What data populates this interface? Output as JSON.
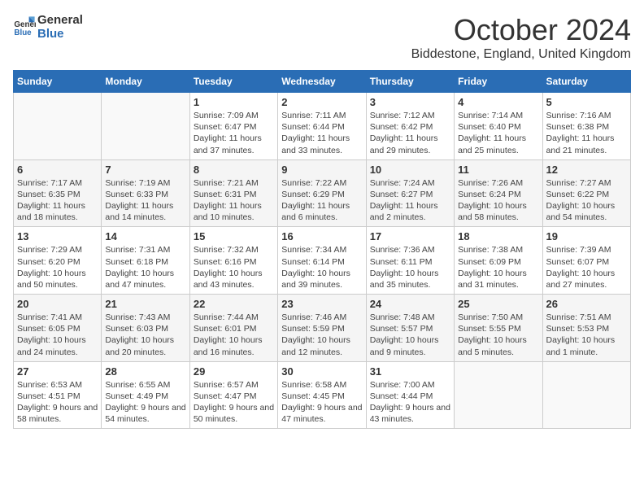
{
  "logo": {
    "text_general": "General",
    "text_blue": "Blue"
  },
  "header": {
    "month": "October 2024",
    "location": "Biddestone, England, United Kingdom"
  },
  "days_of_week": [
    "Sunday",
    "Monday",
    "Tuesday",
    "Wednesday",
    "Thursday",
    "Friday",
    "Saturday"
  ],
  "weeks": [
    [
      {
        "day": "",
        "sunrise": "",
        "sunset": "",
        "daylight": ""
      },
      {
        "day": "",
        "sunrise": "",
        "sunset": "",
        "daylight": ""
      },
      {
        "day": "1",
        "sunrise": "Sunrise: 7:09 AM",
        "sunset": "Sunset: 6:47 PM",
        "daylight": "Daylight: 11 hours and 37 minutes."
      },
      {
        "day": "2",
        "sunrise": "Sunrise: 7:11 AM",
        "sunset": "Sunset: 6:44 PM",
        "daylight": "Daylight: 11 hours and 33 minutes."
      },
      {
        "day": "3",
        "sunrise": "Sunrise: 7:12 AM",
        "sunset": "Sunset: 6:42 PM",
        "daylight": "Daylight: 11 hours and 29 minutes."
      },
      {
        "day": "4",
        "sunrise": "Sunrise: 7:14 AM",
        "sunset": "Sunset: 6:40 PM",
        "daylight": "Daylight: 11 hours and 25 minutes."
      },
      {
        "day": "5",
        "sunrise": "Sunrise: 7:16 AM",
        "sunset": "Sunset: 6:38 PM",
        "daylight": "Daylight: 11 hours and 21 minutes."
      }
    ],
    [
      {
        "day": "6",
        "sunrise": "Sunrise: 7:17 AM",
        "sunset": "Sunset: 6:35 PM",
        "daylight": "Daylight: 11 hours and 18 minutes."
      },
      {
        "day": "7",
        "sunrise": "Sunrise: 7:19 AM",
        "sunset": "Sunset: 6:33 PM",
        "daylight": "Daylight: 11 hours and 14 minutes."
      },
      {
        "day": "8",
        "sunrise": "Sunrise: 7:21 AM",
        "sunset": "Sunset: 6:31 PM",
        "daylight": "Daylight: 11 hours and 10 minutes."
      },
      {
        "day": "9",
        "sunrise": "Sunrise: 7:22 AM",
        "sunset": "Sunset: 6:29 PM",
        "daylight": "Daylight: 11 hours and 6 minutes."
      },
      {
        "day": "10",
        "sunrise": "Sunrise: 7:24 AM",
        "sunset": "Sunset: 6:27 PM",
        "daylight": "Daylight: 11 hours and 2 minutes."
      },
      {
        "day": "11",
        "sunrise": "Sunrise: 7:26 AM",
        "sunset": "Sunset: 6:24 PM",
        "daylight": "Daylight: 10 hours and 58 minutes."
      },
      {
        "day": "12",
        "sunrise": "Sunrise: 7:27 AM",
        "sunset": "Sunset: 6:22 PM",
        "daylight": "Daylight: 10 hours and 54 minutes."
      }
    ],
    [
      {
        "day": "13",
        "sunrise": "Sunrise: 7:29 AM",
        "sunset": "Sunset: 6:20 PM",
        "daylight": "Daylight: 10 hours and 50 minutes."
      },
      {
        "day": "14",
        "sunrise": "Sunrise: 7:31 AM",
        "sunset": "Sunset: 6:18 PM",
        "daylight": "Daylight: 10 hours and 47 minutes."
      },
      {
        "day": "15",
        "sunrise": "Sunrise: 7:32 AM",
        "sunset": "Sunset: 6:16 PM",
        "daylight": "Daylight: 10 hours and 43 minutes."
      },
      {
        "day": "16",
        "sunrise": "Sunrise: 7:34 AM",
        "sunset": "Sunset: 6:14 PM",
        "daylight": "Daylight: 10 hours and 39 minutes."
      },
      {
        "day": "17",
        "sunrise": "Sunrise: 7:36 AM",
        "sunset": "Sunset: 6:11 PM",
        "daylight": "Daylight: 10 hours and 35 minutes."
      },
      {
        "day": "18",
        "sunrise": "Sunrise: 7:38 AM",
        "sunset": "Sunset: 6:09 PM",
        "daylight": "Daylight: 10 hours and 31 minutes."
      },
      {
        "day": "19",
        "sunrise": "Sunrise: 7:39 AM",
        "sunset": "Sunset: 6:07 PM",
        "daylight": "Daylight: 10 hours and 27 minutes."
      }
    ],
    [
      {
        "day": "20",
        "sunrise": "Sunrise: 7:41 AM",
        "sunset": "Sunset: 6:05 PM",
        "daylight": "Daylight: 10 hours and 24 minutes."
      },
      {
        "day": "21",
        "sunrise": "Sunrise: 7:43 AM",
        "sunset": "Sunset: 6:03 PM",
        "daylight": "Daylight: 10 hours and 20 minutes."
      },
      {
        "day": "22",
        "sunrise": "Sunrise: 7:44 AM",
        "sunset": "Sunset: 6:01 PM",
        "daylight": "Daylight: 10 hours and 16 minutes."
      },
      {
        "day": "23",
        "sunrise": "Sunrise: 7:46 AM",
        "sunset": "Sunset: 5:59 PM",
        "daylight": "Daylight: 10 hours and 12 minutes."
      },
      {
        "day": "24",
        "sunrise": "Sunrise: 7:48 AM",
        "sunset": "Sunset: 5:57 PM",
        "daylight": "Daylight: 10 hours and 9 minutes."
      },
      {
        "day": "25",
        "sunrise": "Sunrise: 7:50 AM",
        "sunset": "Sunset: 5:55 PM",
        "daylight": "Daylight: 10 hours and 5 minutes."
      },
      {
        "day": "26",
        "sunrise": "Sunrise: 7:51 AM",
        "sunset": "Sunset: 5:53 PM",
        "daylight": "Daylight: 10 hours and 1 minute."
      }
    ],
    [
      {
        "day": "27",
        "sunrise": "Sunrise: 6:53 AM",
        "sunset": "Sunset: 4:51 PM",
        "daylight": "Daylight: 9 hours and 58 minutes."
      },
      {
        "day": "28",
        "sunrise": "Sunrise: 6:55 AM",
        "sunset": "Sunset: 4:49 PM",
        "daylight": "Daylight: 9 hours and 54 minutes."
      },
      {
        "day": "29",
        "sunrise": "Sunrise: 6:57 AM",
        "sunset": "Sunset: 4:47 PM",
        "daylight": "Daylight: 9 hours and 50 minutes."
      },
      {
        "day": "30",
        "sunrise": "Sunrise: 6:58 AM",
        "sunset": "Sunset: 4:45 PM",
        "daylight": "Daylight: 9 hours and 47 minutes."
      },
      {
        "day": "31",
        "sunrise": "Sunrise: 7:00 AM",
        "sunset": "Sunset: 4:44 PM",
        "daylight": "Daylight: 9 hours and 43 minutes."
      },
      {
        "day": "",
        "sunrise": "",
        "sunset": "",
        "daylight": ""
      },
      {
        "day": "",
        "sunrise": "",
        "sunset": "",
        "daylight": ""
      }
    ]
  ]
}
